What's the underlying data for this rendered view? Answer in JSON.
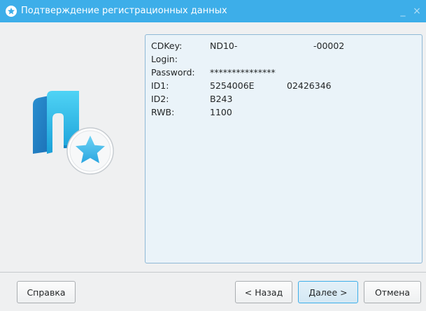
{
  "window": {
    "title": "Подтверждение регистрационных данных",
    "controls": {
      "minimize": "_",
      "close": "×"
    }
  },
  "details": {
    "cdkey_label": "CDKey:",
    "cdkey_part1": "ND10-",
    "cdkey_part2": "-00002",
    "login_label": "Login:",
    "login_value": "",
    "password_label": "Password:",
    "password_value": "***************",
    "id1_label": "ID1:",
    "id1_part1": "5254006E",
    "id1_part2": "02426346",
    "id2_label": "ID2:",
    "id2_value": "B243",
    "rwb_label": "RWB:",
    "rwb_value": "1100"
  },
  "buttons": {
    "help": "Справка",
    "back": "< Назад",
    "next": "Далее >",
    "cancel": "Отмена"
  },
  "colors": {
    "titlebar": "#3daee9",
    "accent": "#3daee9",
    "panel_bg": "#eaf3f9",
    "panel_border": "#8fb8d6",
    "window_bg": "#eff0f1"
  },
  "icons": {
    "title_icon": "star-icon",
    "logo": "app-logo-with-star-badge"
  }
}
